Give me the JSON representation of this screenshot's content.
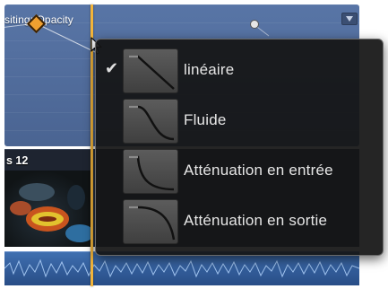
{
  "timeline": {
    "lane_label": "siting: Opacity",
    "clip_name": "s 12"
  },
  "curve_menu": {
    "items": [
      {
        "label": "linéaire",
        "checked": true,
        "curve": "linear-icon"
      },
      {
        "label": "Fluide",
        "checked": false,
        "curve": "smooth-icon"
      },
      {
        "label": "Atténuation en entrée",
        "checked": false,
        "curve": "ease-in-icon"
      },
      {
        "label": "Atténuation en sortie",
        "checked": false,
        "curve": "ease-out-icon"
      }
    ],
    "check_glyph": "✔"
  },
  "colors": {
    "lane_blue": "#5875a6",
    "keyframe_orange": "#f0a030",
    "playhead": "#f2b43a",
    "menu_bg": "#141414"
  }
}
